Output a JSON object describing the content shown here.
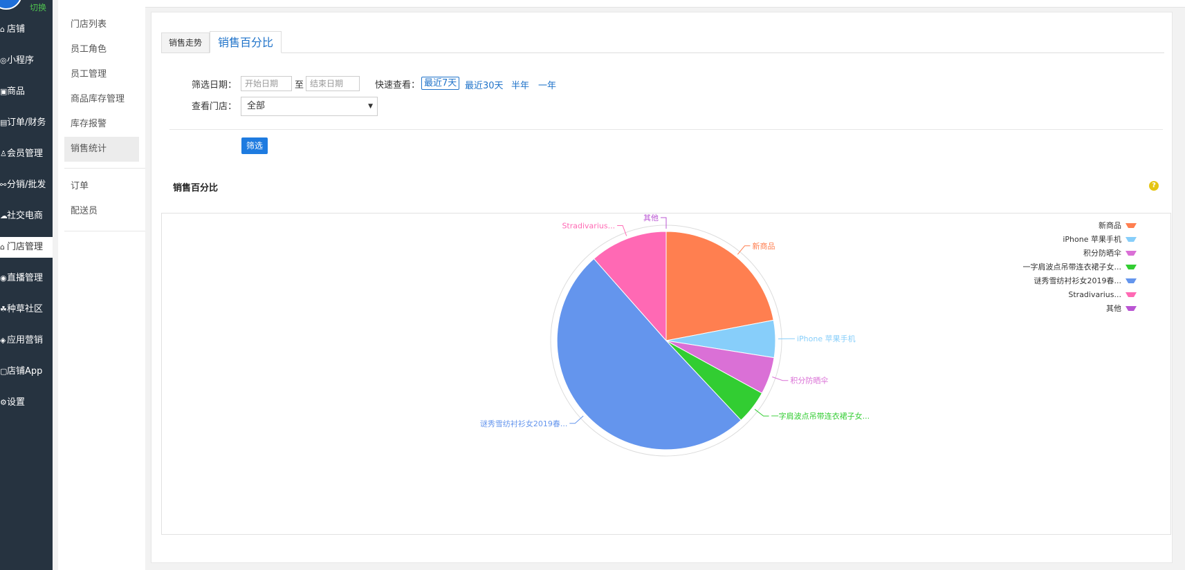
{
  "sidebar": {
    "switch_label": "切换",
    "items": [
      {
        "icon": "store-icon",
        "glyph": "⌂",
        "label": "店铺"
      },
      {
        "icon": "miniprogram-icon",
        "glyph": "◎",
        "label": "小程序"
      },
      {
        "icon": "goods-icon",
        "glyph": "▣",
        "label": "商品"
      },
      {
        "icon": "order-finance-icon",
        "glyph": "▤",
        "label": "订单/财务"
      },
      {
        "icon": "member-icon",
        "glyph": "♙",
        "label": "会员管理"
      },
      {
        "icon": "distribution-icon",
        "glyph": "⚯",
        "label": "分销/批发"
      },
      {
        "icon": "social-ecommerce-icon",
        "glyph": "☁",
        "label": "社交电商"
      },
      {
        "icon": "store-manage-icon",
        "glyph": "⌂",
        "label": "门店管理",
        "active": true
      },
      {
        "icon": "live-icon",
        "glyph": "◉",
        "label": "直播管理"
      },
      {
        "icon": "community-icon",
        "glyph": "☘",
        "label": "种草社区"
      },
      {
        "icon": "app-marketing-icon",
        "glyph": "◈",
        "label": "应用营销"
      },
      {
        "icon": "shop-app-icon",
        "glyph": "▢",
        "label": "店铺App"
      },
      {
        "icon": "settings-icon",
        "glyph": "⚙",
        "label": "设置"
      }
    ]
  },
  "subnav": {
    "group1": [
      "门店列表",
      "员工角色",
      "员工管理",
      "商品库存管理",
      "库存报警",
      "销售统计"
    ],
    "active": "销售统计",
    "group2": [
      "订单",
      "配送员"
    ]
  },
  "tabs": {
    "trend": "销售走势",
    "percent": "销售百分比"
  },
  "filter": {
    "date_label": "筛选日期：",
    "start_placeholder": "开始日期",
    "to_label": "至",
    "end_placeholder": "结束日期",
    "quick_label": "快速查看：",
    "quick_options": [
      "最近7天",
      "最近30天",
      "半年",
      "一年"
    ],
    "quick_selected": "最近7天",
    "store_label": "查看门店：",
    "store_value": "全部",
    "submit_label": "筛选"
  },
  "section_title": "销售百分比",
  "chart_data": {
    "type": "pie",
    "slices": [
      {
        "name": "新商品",
        "value": 22,
        "color": "#ff7f50"
      },
      {
        "name": "iPhone 苹果手机",
        "value": 5.5,
        "color": "#87cefa"
      },
      {
        "name": "积分防晒伞",
        "value": 5.5,
        "color": "#da70d6"
      },
      {
        "name": "一字肩波点吊带连衣裙子女...",
        "value": 5,
        "color": "#32cd32"
      },
      {
        "name": "谜秀雪纺衬衫女2019春...",
        "value": 50.5,
        "color": "#6495ed"
      },
      {
        "name": "Stradivarius...",
        "value": 11.5,
        "color": "#ff69b4"
      },
      {
        "name": "其他",
        "value": 0,
        "color": "#ba55d3"
      }
    ],
    "legend_position": "top-right"
  }
}
